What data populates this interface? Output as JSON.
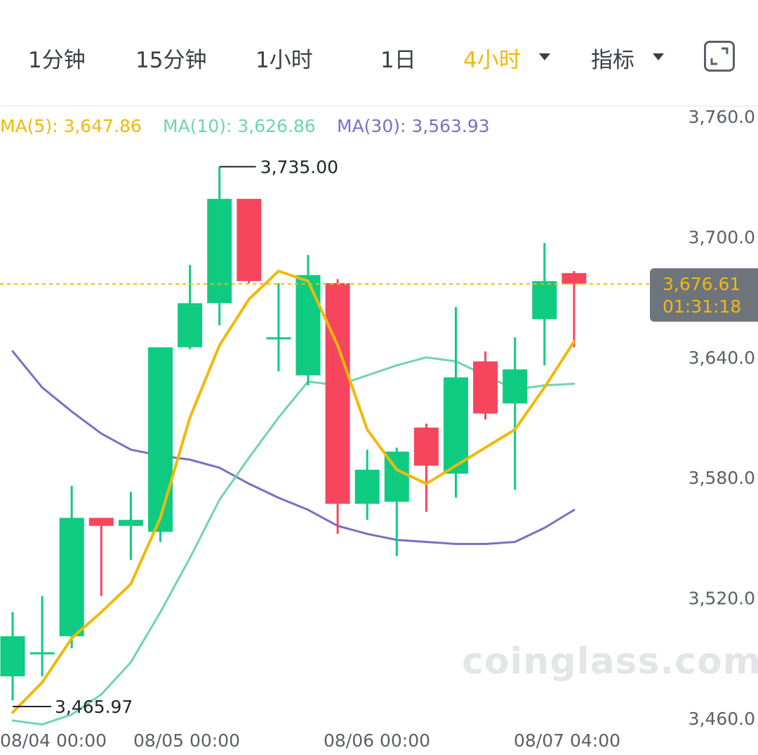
{
  "toolbar": {
    "tabs": [
      {
        "label": "1分钟"
      },
      {
        "label": "15分钟"
      },
      {
        "label": "1小时"
      },
      {
        "label": "1日"
      },
      {
        "label": "4小时"
      },
      {
        "label": "指标"
      }
    ],
    "active_tab": "4小时"
  },
  "ma_legend": {
    "ma5": {
      "label": "MA(5): 3,647.86",
      "color": "#f0b90b"
    },
    "ma10": {
      "label": "MA(10): 3,626.86",
      "color": "#6fd3b4"
    },
    "ma30": {
      "label": "MA(30): 3,563.93",
      "color": "#7b6fc2"
    }
  },
  "current_price": {
    "price": "3,676.61",
    "countdown": "01:31:18"
  },
  "watermark": "coinglass.com",
  "colors": {
    "up": "#0ecb81",
    "down": "#f6465d",
    "accent": "#f0b90b"
  },
  "chart_data": {
    "type": "candlestick",
    "y_axis": {
      "ticks": [
        "3,760.0",
        "3,700.0",
        "3,640.0",
        "3,580.0",
        "3,520.0",
        "3,460.0"
      ],
      "range": [
        3455,
        3772
      ]
    },
    "x_axis": {
      "ticks": [
        "08/04 00:00",
        "08/05 00:00",
        "08/06 00:00",
        "08/07 04:00"
      ]
    },
    "annotations": {
      "high": "3,735.00",
      "low": "3,465.97"
    },
    "high_value": 3735.0,
    "low_value": 3465.97,
    "last_price": 3676.61,
    "candles": [
      {
        "o": 3481,
        "h": 3513,
        "l": 3469,
        "c": 3501
      },
      {
        "o": 3493,
        "h": 3521,
        "l": 3481,
        "c": 3493
      },
      {
        "o": 3501,
        "h": 3576,
        "l": 3495,
        "c": 3560
      },
      {
        "o": 3560,
        "h": 3551,
        "l": 3521,
        "c": 3556
      },
      {
        "o": 3556,
        "h": 3573,
        "l": 3539,
        "c": 3559
      },
      {
        "o": 3553,
        "h": 3641,
        "l": 3548,
        "c": 3645
      },
      {
        "o": 3645,
        "h": 3686,
        "l": 3644,
        "c": 3667
      },
      {
        "o": 3667,
        "h": 3735,
        "l": 3656,
        "c": 3719
      },
      {
        "o": 3719,
        "h": 3719,
        "l": 3677,
        "c": 3678
      },
      {
        "o": 3650,
        "h": 3677,
        "l": 3633,
        "c": 3650
      },
      {
        "o": 3631,
        "h": 3691,
        "l": 3626,
        "c": 3681
      },
      {
        "o": 3677,
        "h": 3679,
        "l": 3552,
        "c": 3567
      },
      {
        "o": 3567,
        "h": 3594,
        "l": 3559,
        "c": 3584
      },
      {
        "o": 3568,
        "h": 3595,
        "l": 3541,
        "c": 3593
      },
      {
        "o": 3605,
        "h": 3607,
        "l": 3563,
        "c": 3586
      },
      {
        "o": 3582,
        "h": 3665,
        "l": 3570,
        "c": 3630
      },
      {
        "o": 3638,
        "h": 3643,
        "l": 3609,
        "c": 3612
      },
      {
        "o": 3617,
        "h": 3650,
        "l": 3574,
        "c": 3634
      },
      {
        "o": 3659,
        "h": 3697,
        "l": 3636,
        "c": 3678
      },
      {
        "o": 3682,
        "h": 3683,
        "l": 3645,
        "c": 3676.61
      }
    ],
    "ma5": [
      3463,
      3478,
      3500,
      3513,
      3527,
      3560,
      3610,
      3646,
      3669,
      3683,
      3678,
      3646,
      3604,
      3584,
      3577,
      3586,
      3595,
      3604,
      3625,
      3647.86
    ],
    "ma10": [
      3459,
      3457,
      3462,
      3472,
      3488,
      3513,
      3540,
      3569,
      3590,
      3610,
      3628,
      3626,
      3631,
      3636,
      3640,
      3638,
      3631,
      3624,
      3626,
      3626.86
    ],
    "ma30": [
      3643,
      3625,
      3613,
      3602,
      3594,
      3591,
      3589,
      3585,
      3577,
      3570,
      3564,
      3556,
      3552,
      3549,
      3548,
      3547,
      3547,
      3548,
      3555,
      3563.93
    ]
  }
}
